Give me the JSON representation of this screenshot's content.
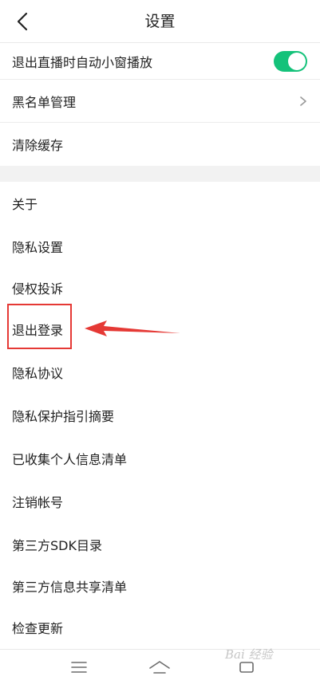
{
  "header": {
    "title": "设置",
    "back_icon": "chevron-left-icon"
  },
  "settings": {
    "auto_mini_window": {
      "label": "退出直播时自动小窗播放",
      "toggle_on": true
    },
    "blacklist": {
      "label": "黑名单管理"
    },
    "clear_cache": {
      "label": "清除缓存"
    },
    "items": [
      {
        "label": "关于"
      },
      {
        "label": "隐私设置"
      },
      {
        "label": "侵权投诉"
      },
      {
        "label": "退出登录"
      },
      {
        "label": "隐私协议"
      },
      {
        "label": "隐私保护指引摘要"
      },
      {
        "label": "已收集个人信息清单"
      },
      {
        "label": "注销帐号"
      },
      {
        "label": "第三方SDK目录"
      },
      {
        "label": "第三方信息共享清单"
      },
      {
        "label": "检查更新"
      }
    ]
  },
  "annotation": {
    "highlight_color": "#e53935",
    "highlighted_item": "退出登录"
  },
  "watermark": {
    "text": "Bai 经验"
  },
  "colors": {
    "toggle_on": "#14c27a",
    "section_gap": "#f2f2f2"
  }
}
